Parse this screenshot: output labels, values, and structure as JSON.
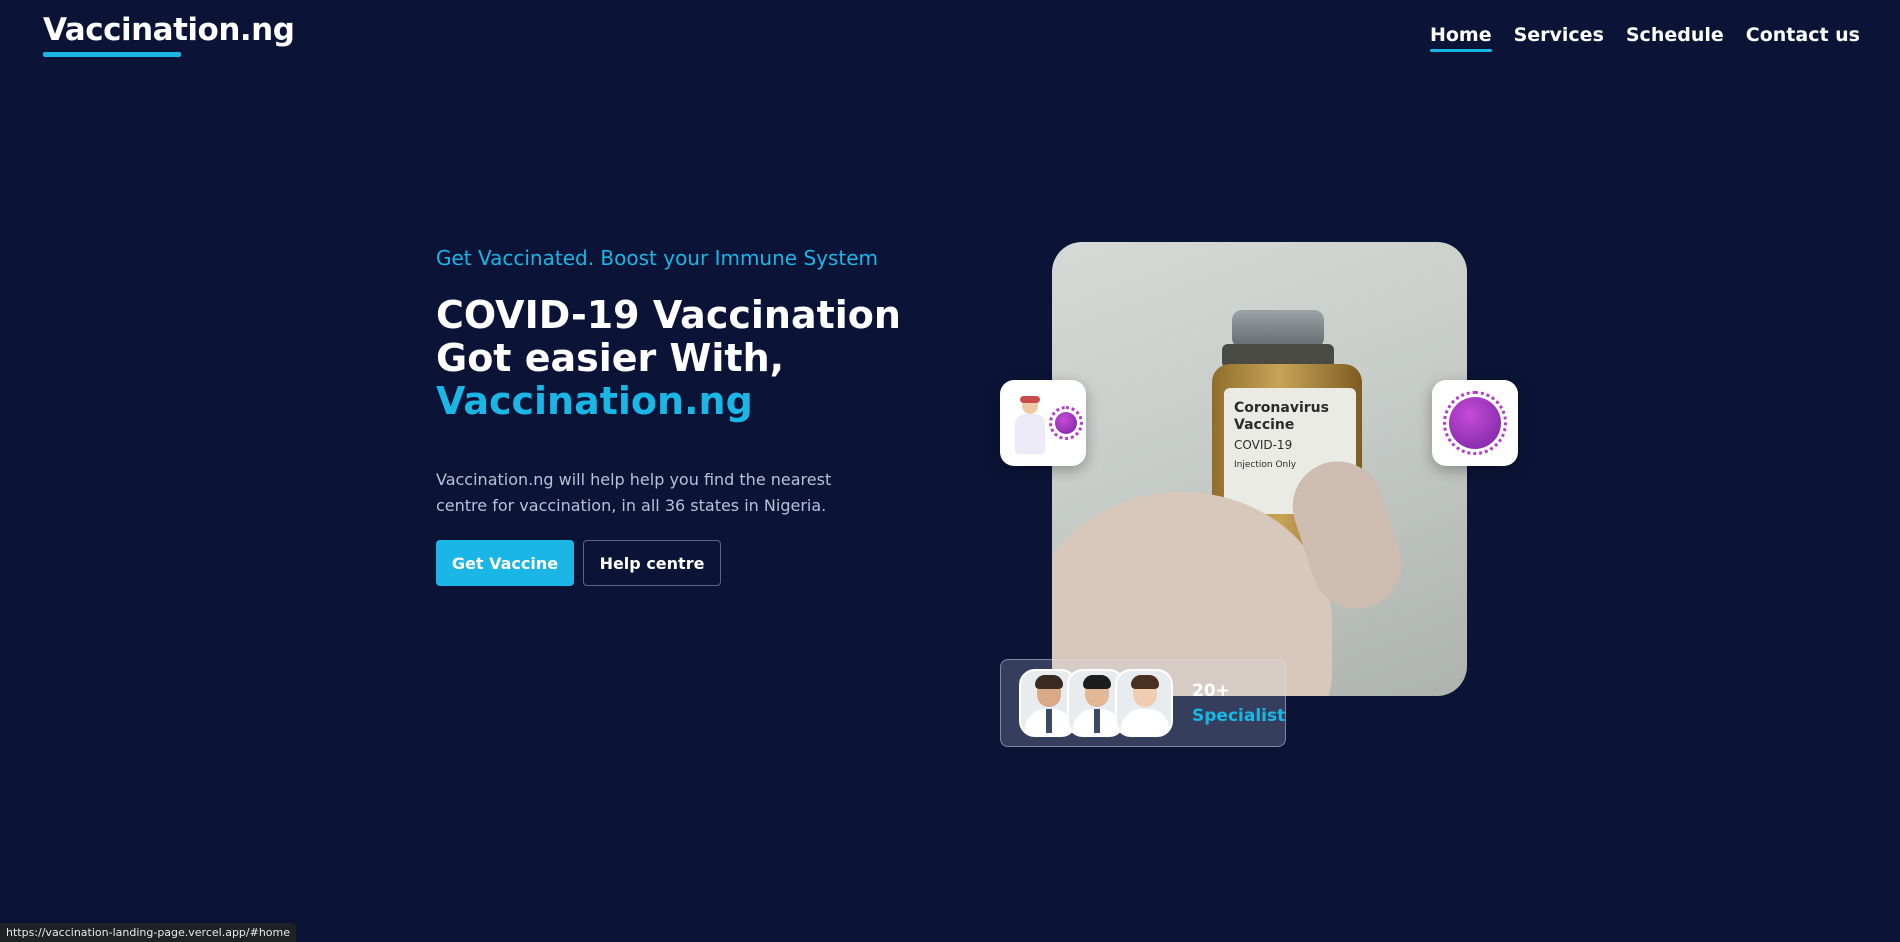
{
  "header": {
    "logo": "Vaccination.ng",
    "nav": [
      {
        "label": "Home",
        "active": true
      },
      {
        "label": "Services",
        "active": false
      },
      {
        "label": "Schedule",
        "active": false
      },
      {
        "label": "Contact us",
        "active": false
      }
    ]
  },
  "hero": {
    "tagline": "Get Vaccinated. Boost your Immune System",
    "headline_line1": "COVID-19 Vaccination",
    "headline_line2": "Got easier With,",
    "headline_brand": "Vaccination.ng",
    "description": "Vaccination.ng will help help you find the nearest centre for vaccination, in all 36 states in Nigeria.",
    "primary_button": "Get Vaccine",
    "secondary_button": "Help centre"
  },
  "image": {
    "vial_label_line1": "Coronavirus",
    "vial_label_line2": "Vaccine",
    "vial_label_line3": "COVID-19",
    "vial_label_line4": "Injection Only"
  },
  "specialists": {
    "count": "20+",
    "label": "Specialist"
  },
  "status_bar": {
    "url": "https://vaccination-landing-page.vercel.app/#home"
  },
  "colors": {
    "background": "#0b1437",
    "accent": "#1ab6e6",
    "text": "#ffffff",
    "muted_text": "#b9c1d6"
  }
}
